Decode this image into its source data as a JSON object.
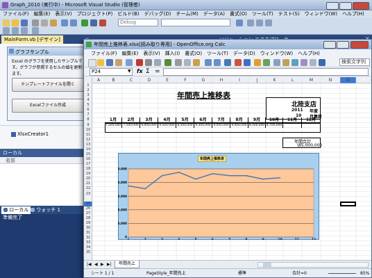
{
  "vs": {
    "title": "Graph_2010 (実行中) - Microsoft Visual Studio (管理者)",
    "menu": [
      "ファイル(F)",
      "編集(E)",
      "表示(V)",
      "プロジェクト(P)",
      "ビルド(B)",
      "デバッグ(D)",
      "チーム(M)",
      "データ(A)",
      "書式(O)",
      "ツール(T)",
      "テスト(S)",
      "ウィンドウ(W)",
      "ヘルプ(H)"
    ],
    "debug_combo": "Debug",
    "doc_tab": "MainForm.vb [デザイン]",
    "solution_tab": "ソリューション エクスプローラー",
    "component": "XlsxCreator1",
    "locals_title": "ローカル",
    "locals_col": "名前",
    "bottom_tabs": [
      "ローカル",
      "ウォッチ 1"
    ],
    "status": "準備完了"
  },
  "form": {
    "title": "グラフサンプル",
    "description": "Excel のグラフを使用したサンプルです。グラフが参照するセルの値を更新します。",
    "button_open": "テンプレートファイルを開く",
    "button_create": "Excelファイル作成"
  },
  "calc": {
    "title": "年間売上推移表.xlsx[読み取り専用] - OpenOffice.org Calc",
    "menu": [
      "ファイル(F)",
      "編集(E)",
      "表示(V)",
      "挿入(I)",
      "書式(O)",
      "ツール(T)",
      "データ(D)",
      "ウィンドウ(W)",
      "ヘルプ(H)"
    ],
    "find_label": "検索文字列",
    "name_box": "P24",
    "formula_prefix": "=",
    "columns": [
      "A",
      "B",
      "C",
      "D",
      "E",
      "F",
      "G",
      "H",
      "I",
      "J",
      "K",
      "L",
      "M",
      "N",
      "O",
      "P",
      "Q"
    ],
    "rows": [
      "1",
      "2",
      "3",
      "4",
      "5",
      "6",
      "7",
      "8",
      "9",
      "10",
      "11",
      "12",
      "13",
      "14",
      "15",
      "16",
      "17",
      "18",
      "19",
      "20",
      "21",
      "22",
      "23",
      "24",
      "25",
      "26",
      "27",
      "28",
      "29",
      "30",
      "31",
      "32",
      "33",
      "34",
      "35"
    ],
    "sheet_title": "年間売上推移表",
    "branch": "北陸支店",
    "year_value": "2011",
    "year_label": "年度",
    "month_value": "10",
    "month_label": "月集計",
    "months": [
      "1月",
      "2月",
      "3月",
      "4月",
      "5月",
      "6月",
      "7月",
      "8月",
      "9月",
      "10月",
      "11月",
      "12月"
    ],
    "values": [
      "7,500,000",
      "7,100,000",
      "9,000,000",
      "9,500,000",
      "8,500,000",
      "9,300,000",
      "9,000,000",
      "9,000,000",
      "8,500,000",
      "8,700,000",
      "",
      ""
    ],
    "total_label": "年間合計",
    "total_value": "\\85,000,000",
    "sheet_tab": "年間売上",
    "status_sheet": "シート 1 / 1",
    "status_style": "PageStyle_年間売上",
    "status_mode": "標準",
    "status_sum": "合計=0",
    "zoom": "85%"
  },
  "chart_data": {
    "type": "line",
    "title": "年間売上推移表",
    "x": [
      1,
      2,
      3,
      4,
      5,
      6,
      7,
      8,
      9,
      10,
      11,
      12
    ],
    "series": [
      {
        "values": [
          7500000,
          7100000,
          9000000,
          9500000,
          8500000,
          9300000,
          9000000,
          9000000,
          8500000,
          8700000,
          null,
          null
        ]
      }
    ],
    "y_ticks": [
      "0",
      "2,000,000",
      "4,000,000",
      "6,000,000",
      "8,000,000",
      "10,000,000"
    ],
    "x_ticks": [
      "1",
      "2",
      "3",
      "4",
      "5",
      "6",
      "7",
      "8",
      "9",
      "10",
      "11",
      "12"
    ],
    "ylim": [
      0,
      10000000
    ],
    "xlim": [
      1,
      12
    ],
    "grid": true,
    "line_color": "#4a7ab5",
    "plot_bg": "#ffc89b",
    "outer_bg": "#a8d0ee"
  }
}
